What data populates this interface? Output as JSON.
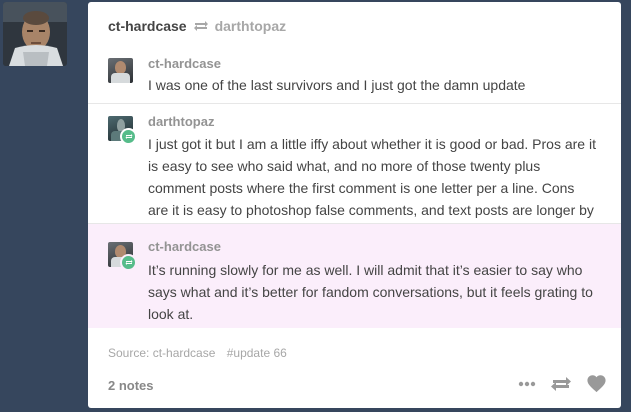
{
  "post": {
    "author": "ct-hardcase",
    "reblogged_from": "darthtopaz",
    "replies": [
      {
        "user": "ct-hardcase",
        "text": "I was one of the last survivors and I just got the damn update",
        "highlighted": false
      },
      {
        "user": "darthtopaz",
        "text": "I just got it but I am a little iffy about whether it is good or bad. Pros are it is easy to see who said what, and no more of those twenty plus comment posts where the first comment is one letter per a line. Cons are it is easy to photoshop false comments, and text posts are longer by a lot.",
        "highlighted": false
      },
      {
        "user": "ct-hardcase",
        "text": "It’s running slowly for me as well. I will admit that it’s easier to say who says what and it’s better for fandom conversations, but it feels grating to look at.",
        "highlighted": true
      }
    ],
    "source_label": "Source: ct-hardcase",
    "tag": "#update 66",
    "notes": "2 notes"
  },
  "colors": {
    "background": "#36465d",
    "highlight": "#fbeefb",
    "reblog_green": "#56bc8a"
  },
  "icons": [
    "reblog-icon",
    "more-dots-icon",
    "heart-icon"
  ]
}
